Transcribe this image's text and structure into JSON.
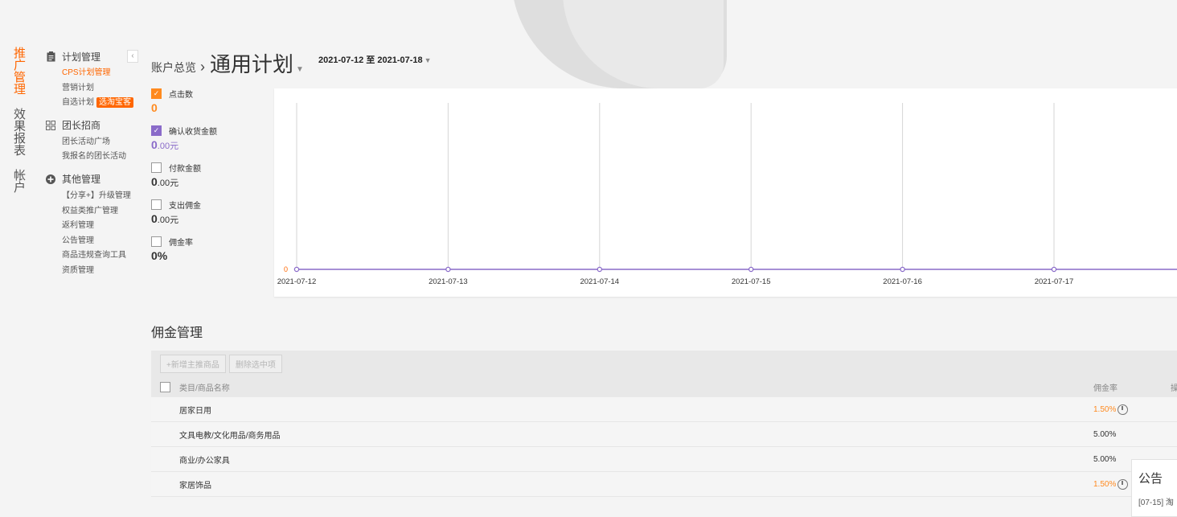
{
  "main_nav": [
    {
      "label": "推广管理",
      "active": true
    },
    {
      "label": "效果报表",
      "active": false
    },
    {
      "label": "帐户",
      "active": false
    }
  ],
  "sub_nav": {
    "collapse_icon": "chevron-left-icon",
    "groups": [
      {
        "title": "计划管理",
        "icon": "clipboard-icon",
        "items": [
          "CPS计划管理",
          "营销计划",
          "自选计划"
        ],
        "badge": "选淘宝客"
      },
      {
        "title": "团长招商",
        "icon": "grid-icon",
        "items": [
          "团长活动广场",
          "我报名的团长活动"
        ]
      },
      {
        "title": "其他管理",
        "icon": "plus-circle-icon",
        "items": [
          "【分享+】升级管理",
          "权益类推广管理",
          "返利管理",
          "公告管理",
          "商品违规查询工具",
          "资质管理"
        ]
      }
    ]
  },
  "header": {
    "breadcrumb_root": "账户总览",
    "separator": "›",
    "title": "通用计划",
    "date_range": "2021-07-12 至 2021-07-18"
  },
  "metrics": [
    {
      "label": "点击数",
      "checked": true,
      "color": "#ff8a1f",
      "value": "0",
      "unit": ""
    },
    {
      "label": "确认收货金额",
      "checked": true,
      "color": "#8a6bc9",
      "value": "0",
      "unit": ".00元"
    },
    {
      "label": "付款金额",
      "checked": false,
      "color": "#333333",
      "value": "0",
      "unit": ".00元"
    },
    {
      "label": "支出佣金",
      "checked": false,
      "color": "#333333",
      "value": "0",
      "unit": ".00元"
    },
    {
      "label": "佣金率",
      "checked": false,
      "color": "#333333",
      "value": "0%",
      "unit": ""
    }
  ],
  "chart_data": {
    "type": "line",
    "x": [
      "2021-07-12",
      "2021-07-13",
      "2021-07-14",
      "2021-07-15",
      "2021-07-16",
      "2021-07-17"
    ],
    "series": [
      {
        "values": [
          0,
          0,
          0,
          0,
          0,
          0
        ],
        "color": "#8a6bc9"
      }
    ],
    "y_tick_label": "0",
    "grid": true
  },
  "commission": {
    "title": "佣金管理",
    "buttons": [
      "+新增主推商品",
      "删除选中项"
    ],
    "columns": {
      "name": "类目/商品名称",
      "rate": "佣金率",
      "extra": "操"
    },
    "rows": [
      {
        "name": "居家日用",
        "rate": "1.50%",
        "highlight": true
      },
      {
        "name": "文具电教/文化用品/商务用品",
        "rate": "5.00%",
        "highlight": false
      },
      {
        "name": "商业/办公家具",
        "rate": "5.00%",
        "highlight": false
      },
      {
        "name": "家居饰品",
        "rate": "1.50%",
        "highlight": true
      }
    ]
  },
  "notice": {
    "title": "公告",
    "item": "[07-15]  淘"
  }
}
